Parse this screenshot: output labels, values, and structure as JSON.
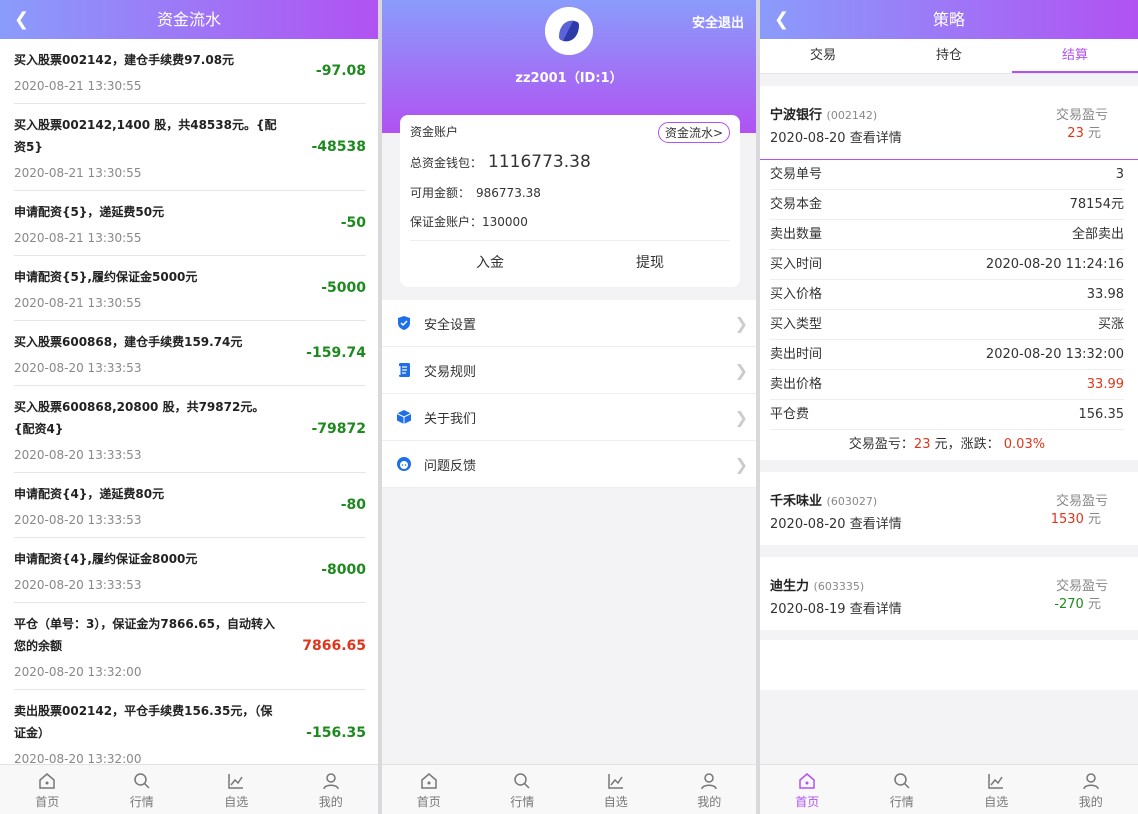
{
  "screen1": {
    "title": "资金流水",
    "items": [
      {
        "desc": "买入股票002142，建仓手续费97.08元",
        "time": "2020-08-21 13:30:55",
        "amount": "-97.08",
        "kind": "neg"
      },
      {
        "desc": "买入股票002142,1400 股，共48538元。{配资5}",
        "time": "2020-08-21 13:30:55",
        "amount": "-48538",
        "kind": "neg"
      },
      {
        "desc": "申请配资{5}，递延费50元",
        "time": "2020-08-21 13:30:55",
        "amount": "-50",
        "kind": "neg"
      },
      {
        "desc": "申请配资{5},履约保证金5000元",
        "time": "2020-08-21 13:30:55",
        "amount": "-5000",
        "kind": "neg"
      },
      {
        "desc": "买入股票600868，建仓手续费159.74元",
        "time": "2020-08-20 13:33:53",
        "amount": "-159.74",
        "kind": "neg"
      },
      {
        "desc": "买入股票600868,20800 股，共79872元。{配资4}",
        "time": "2020-08-20 13:33:53",
        "amount": "-79872",
        "kind": "neg"
      },
      {
        "desc": "申请配资{4}，递延费80元",
        "time": "2020-08-20 13:33:53",
        "amount": "-80",
        "kind": "neg"
      },
      {
        "desc": "申请配资{4},履约保证金8000元",
        "time": "2020-08-20 13:33:53",
        "amount": "-8000",
        "kind": "neg"
      },
      {
        "desc": "平仓（单号：3），保证金为7866.65，自动转入您的余额",
        "time": "2020-08-20 13:32:00",
        "amount": "7866.65",
        "kind": "pos"
      },
      {
        "desc": "卖出股票002142，平仓手续费156.35元，（保证金）",
        "time": "2020-08-20 13:32:00",
        "amount": "-156.35",
        "kind": "neg"
      }
    ]
  },
  "tabbar": {
    "home": "首页",
    "market": "行情",
    "watch": "自选",
    "mine": "我的"
  },
  "screen2": {
    "logout": "安全退出",
    "username": "zz2001（ID:1）",
    "account_title": "资金账户",
    "flow_link": "资金流水>",
    "total_label": "总资金钱包：",
    "total_value": "1116773.38",
    "avail_label": "可用金额：",
    "avail_value": "986773.38",
    "margin_label": "保证金账户：",
    "margin_value": "130000",
    "deposit": "入金",
    "withdraw": "提现",
    "menu": [
      "安全设置",
      "交易规则",
      "关于我们",
      "问题反馈"
    ]
  },
  "screen3": {
    "title": "策略",
    "tabs": [
      "交易",
      "持仓",
      "结算"
    ],
    "pl_label": "交易盈亏",
    "unit": "元",
    "view_detail": "查看详情",
    "cards": [
      {
        "name": "宁波银行",
        "code": "(002142)",
        "date": "2020-08-20",
        "pl": "23"
      },
      {
        "name": "千禾味业",
        "code": "(603027)",
        "date": "2020-08-20",
        "pl": "1530"
      },
      {
        "name": "迪生力",
        "code": "(603335)",
        "date": "2020-08-19",
        "pl": "-270"
      }
    ],
    "detail": [
      {
        "label": "交易单号",
        "value": "3"
      },
      {
        "label": "交易本金",
        "value": "78154元"
      },
      {
        "label": "卖出数量",
        "value": "全部卖出"
      },
      {
        "label": "买入时间",
        "value": "2020-08-20 11:24:16"
      },
      {
        "label": "买入价格",
        "value": "33.98"
      },
      {
        "label": "买入类型",
        "value": "买涨"
      },
      {
        "label": "卖出时间",
        "value": "2020-08-20 13:32:00"
      },
      {
        "label": "卖出价格",
        "value": "33.99"
      },
      {
        "label": "平仓费",
        "value": "156.35"
      }
    ],
    "summary": {
      "label": "交易盈亏：",
      "pl": "23",
      "unit": "元，涨跌：",
      "pct": "0.03%"
    }
  }
}
